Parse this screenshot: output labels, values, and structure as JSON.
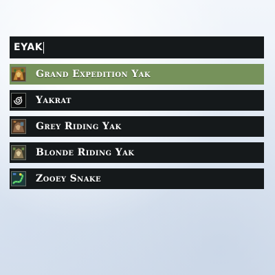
{
  "search": {
    "value": "EYAK"
  },
  "results": [
    {
      "label": "Grand Expedition Yak",
      "icon": "yak-mount-icon"
    },
    {
      "label": "Yakrat",
      "icon": "spiral-icon"
    },
    {
      "label": "Grey Riding Yak",
      "icon": "yak-mount-icon"
    },
    {
      "label": "Blonde Riding Yak",
      "icon": "yak-mount-icon"
    },
    {
      "label": "Zooey Snake",
      "icon": "snake-icon"
    }
  ],
  "selected_index": 0,
  "colors": {
    "row_background": "#15191b",
    "selected_background": "#76925b",
    "text": "#ffffff"
  }
}
